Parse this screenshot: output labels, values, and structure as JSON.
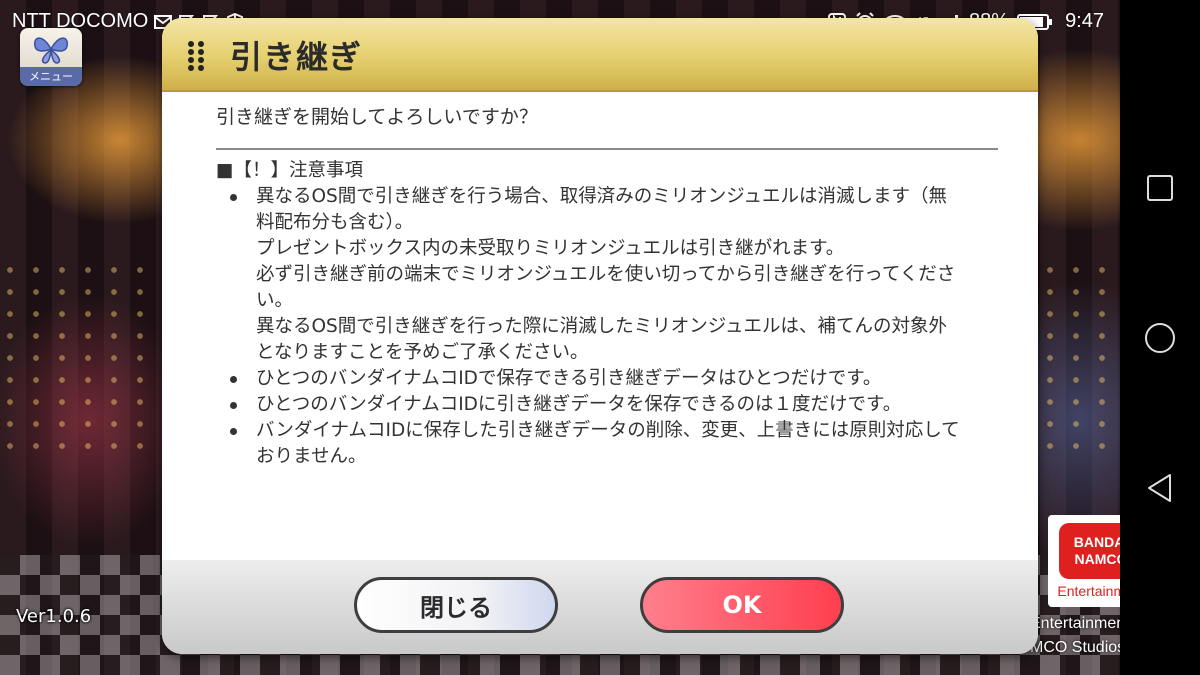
{
  "status_bar": {
    "carrier": "NTT DOCOMO",
    "battery": "88%",
    "time": "9:47",
    "network": "4G"
  },
  "game": {
    "menu_label": "メニュー",
    "version": "Ver1.0.6",
    "publisher_logo": {
      "line1": "BANDAI",
      "line2": "NAMCO",
      "line3": "Entertainment"
    },
    "copyright_line1": "Entertainment Inc.",
    "copyright_line2": "MCO Studios Inc."
  },
  "dialog": {
    "title": "引き継ぎ",
    "question": "引き継ぎを開始してよろしいですか？",
    "notice_heading": "■【！】注意事項",
    "bullets": [
      {
        "lines": [
          "異なるOS間で引き継ぎを行う場合、取得済みのミリオンジュエルは消滅します（無",
          "料配布分も含む）。",
          "プレゼントボックス内の未受取りミリオンジュエルは引き継がれます。",
          "必ず引き継ぎ前の端末でミリオンジュエルを使い切ってから引き継ぎを行ってくださ",
          "い。",
          "異なるOS間で引き継ぎを行った際に消滅したミリオンジュエルは、補てんの対象外",
          "となりますことを予めご了承ください。"
        ]
      },
      {
        "lines": [
          "ひとつのバンダイナムコIDで保存できる引き継ぎデータはひとつだけです。"
        ]
      },
      {
        "lines": [
          "ひとつのバンダイナムコIDに引き継ぎデータを保存できるのは１度だけです。"
        ]
      },
      {
        "lines": [
          "バンダイナムコIDに保存した引き継ぎデータの削除、変更、上書きには原則対応して",
          "おりません。"
        ]
      }
    ],
    "close_label": "閉じる",
    "ok_label": "OK"
  },
  "colors": {
    "header_gold": "#e5cf6e",
    "ok_red": "#ff5a6a",
    "close_blue": "#cfd8ef"
  }
}
